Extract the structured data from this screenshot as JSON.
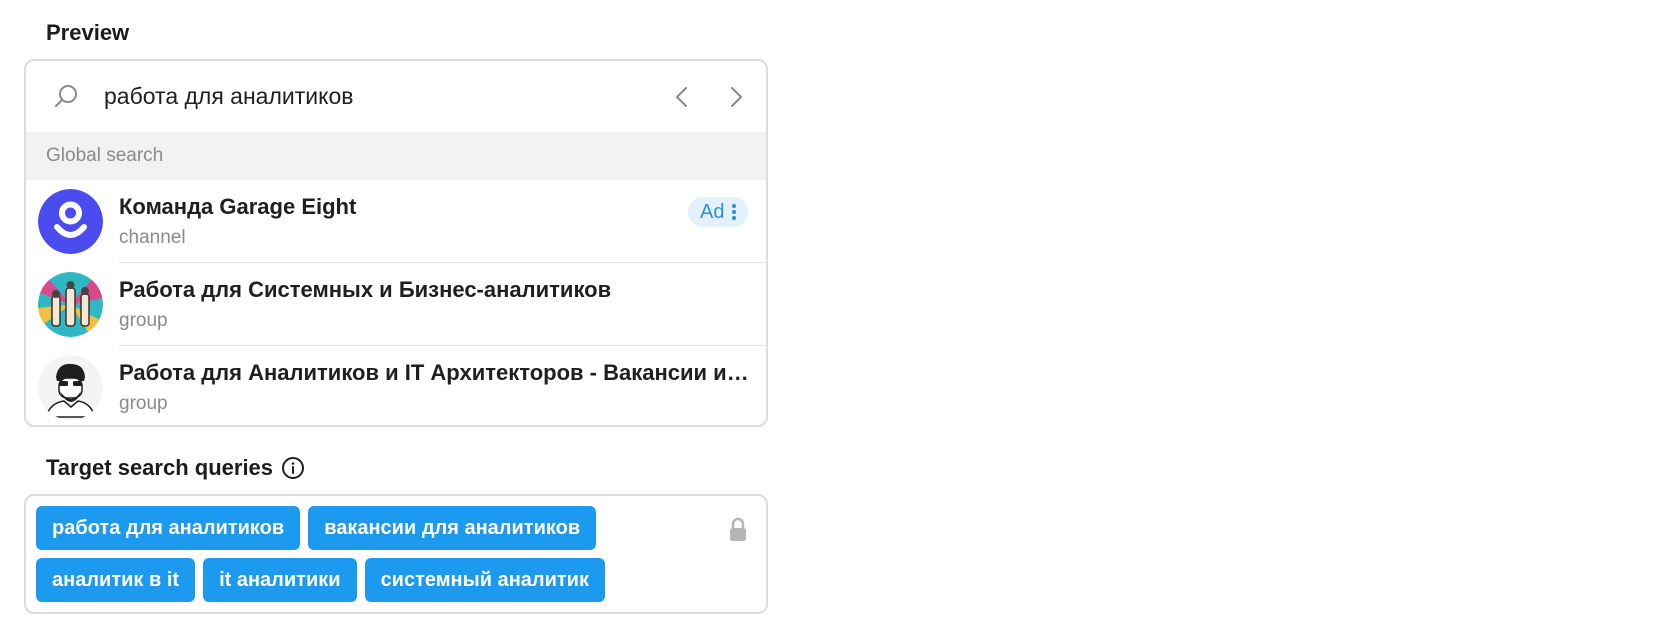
{
  "preview": {
    "title": "Preview",
    "search_query": "работа для аналитиков",
    "section_label": "Global search",
    "results": [
      {
        "name": "Команда Garage Eight",
        "kind": "channel",
        "ad_label": "Ad",
        "avatar": "garage-eight-logo"
      },
      {
        "name": "Работа для Системных и Бизнес-аналитиков",
        "kind": "group",
        "avatar": "illustrated-hands-avatar"
      },
      {
        "name": "Работа для Аналитиков и IT Архитекторов - Вакансии и резюме",
        "kind": "group",
        "avatar": "bearded-man-avatar"
      }
    ]
  },
  "targets": {
    "title": "Target search queries",
    "queries": [
      "работа для аналитиков",
      "вакансии для аналитиков",
      "аналитик в it",
      "it аналитики",
      "системный аналитик"
    ]
  },
  "colors": {
    "chip": "#1b9af0",
    "ad_badge_bg": "#e3f1fc",
    "ad_badge_text": "#2a8fd9",
    "garage_logo": "#4a4cf0"
  },
  "icons": {
    "search": "search-icon",
    "prev": "chevron-left-icon",
    "next": "chevron-right-icon",
    "info": "info-icon",
    "lock": "lock-icon",
    "more": "vertical-dots-icon"
  }
}
